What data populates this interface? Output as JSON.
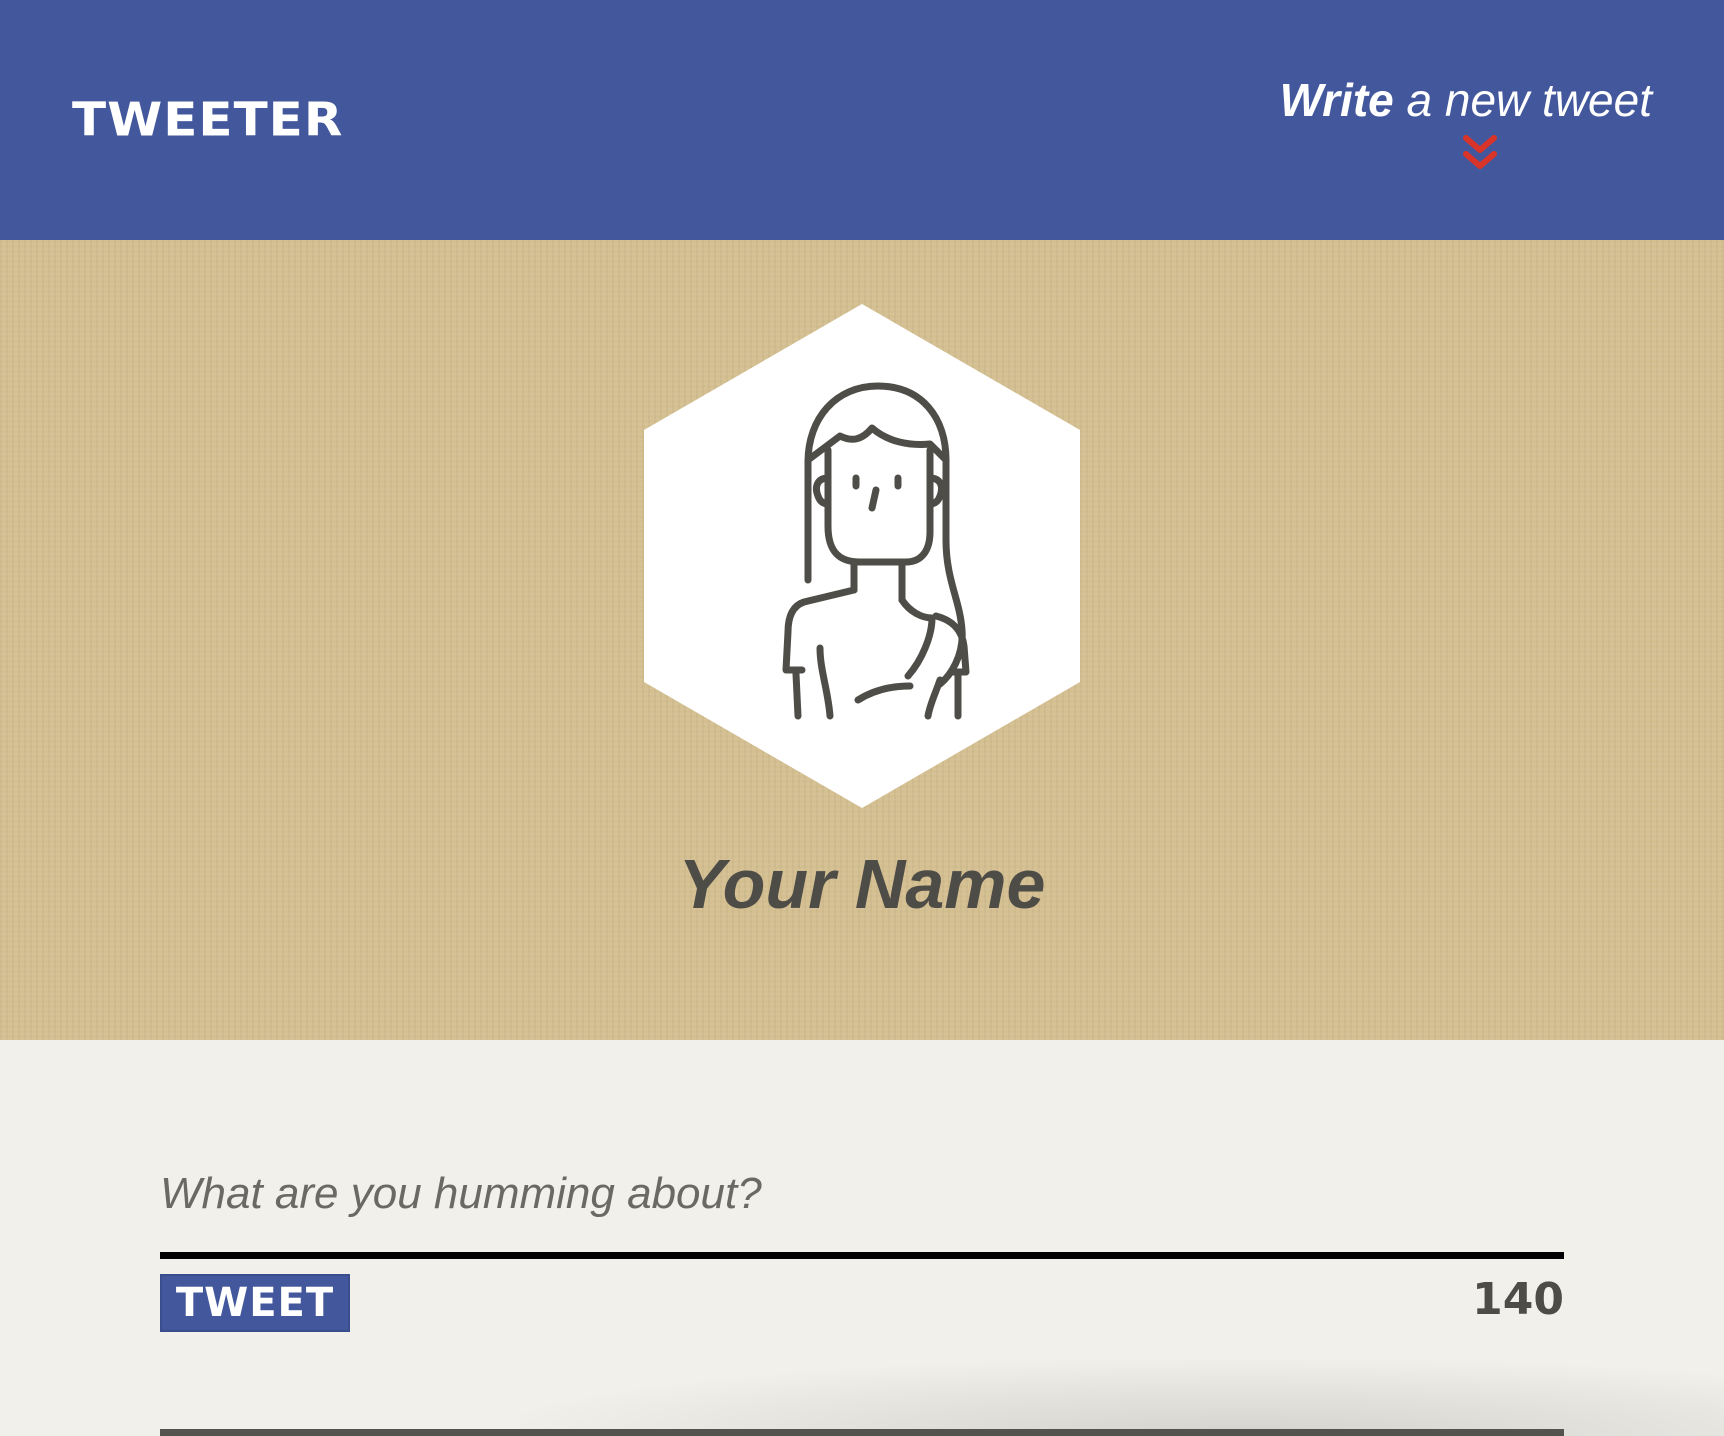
{
  "header": {
    "brand": "TWEETER",
    "write_link": {
      "strong": "Write",
      "rest": " a new tweet"
    },
    "chevron_icon": "double-chevron-down-icon",
    "chevron_color": "#d9332a"
  },
  "profile": {
    "avatar_icon": "woman-avatar-icon",
    "name": "Your Name"
  },
  "compose": {
    "placeholder": "What are you humming about?",
    "value": "",
    "tweet_button": "TWEET",
    "char_count": "140"
  },
  "colors": {
    "header_bg": "#43579c",
    "profile_bg": "#d4bf90",
    "page_bg": "#f2f0eb",
    "text_dark": "#4e4c47"
  }
}
